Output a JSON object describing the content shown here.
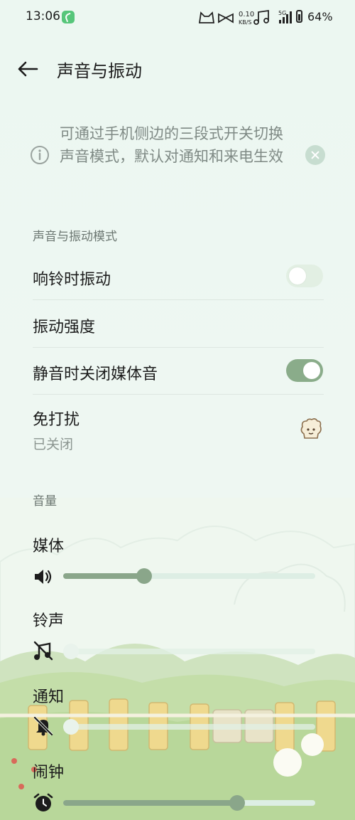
{
  "status_bar": {
    "time": "13:06",
    "net_speed_value": "0.10",
    "net_speed_unit": "KB/S",
    "signal_label": "5G",
    "battery": "64%"
  },
  "header": {
    "title": "声音与振动"
  },
  "notice": {
    "text": "可通过手机侧边的三段式开关切换声音模式，默认对通知和来电生效"
  },
  "mode_section": {
    "title": "声音与振动模式",
    "ring_vibrate": {
      "label": "响铃时振动",
      "enabled": false
    },
    "vibration_intensity": {
      "label": "振动强度"
    },
    "mute_media": {
      "label": "静音时关闭媒体音",
      "enabled": true
    },
    "dnd": {
      "label": "免打扰",
      "status": "已关闭"
    }
  },
  "volume_section": {
    "title": "音量",
    "media": {
      "label": "媒体",
      "level": 0.32
    },
    "ringtone": {
      "label": "铃声",
      "level": 0.0
    },
    "notification": {
      "label": "通知",
      "level": 0.0
    },
    "alarm": {
      "label": "闹钟",
      "level": 0.69
    }
  },
  "colors": {
    "accent": "#8aa68a",
    "toggle_on": "#8aac8a",
    "background": "#ecf7f1"
  }
}
